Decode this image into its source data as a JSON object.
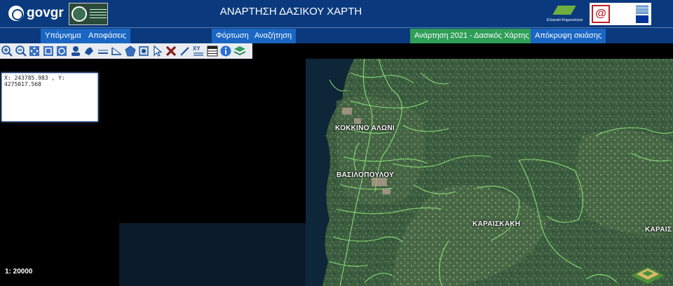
{
  "header": {
    "brand": "govgr",
    "title": "ΑΝΑΡΤΗΣΗ ΔΑΣΙΚΟΥ ΧΑΡΤΗ",
    "ktima_caption": "Ελληνικό Κτηματολόγιο"
  },
  "menu": {
    "legend": "Υπόμνημα",
    "decisions": "Αποφάσεις",
    "upload": "Φόρτωση",
    "search": "Αναζήτηση",
    "posting": "Ανάρτηση 2021 - Δασικός Χάρτης",
    "hide_shading": "Απόκρυψη σκιάσης"
  },
  "toolbar": {
    "icons": [
      "zoom-in-icon",
      "zoom-out-icon",
      "pan-icon",
      "zoom-extent-icon",
      "zoom-window-icon",
      "identify-icon",
      "measure-area-icon",
      "measure-distance-icon",
      "draw-line-icon",
      "draw-polygon-icon",
      "draw-shape-icon",
      "select-icon",
      "delete-icon",
      "edit-icon",
      "xy-coordinates-icon",
      "table-icon",
      "info-icon",
      "layers-icon"
    ],
    "xy_label": "XY"
  },
  "coordinates": {
    "text": "X: 243785.983 , Y: 4275017.568"
  },
  "map": {
    "places": [
      "ΚΟΚΚΙΝΟ ΑΛΩΝΙ",
      "ΒΑΣΙΛΟΠΟΥΛΟΥ",
      "ΚΑΡΑΙΣΚΑΚΗ",
      "ΚΑΡΑΙΣ"
    ],
    "scale": "1: 20000"
  },
  "colors": {
    "header": "#0a3a7d",
    "menu_button": "#1a66c2",
    "posting_button": "#2f9e58",
    "parcel_lines": "#8fe87a",
    "forest": "#3a5a3c"
  }
}
